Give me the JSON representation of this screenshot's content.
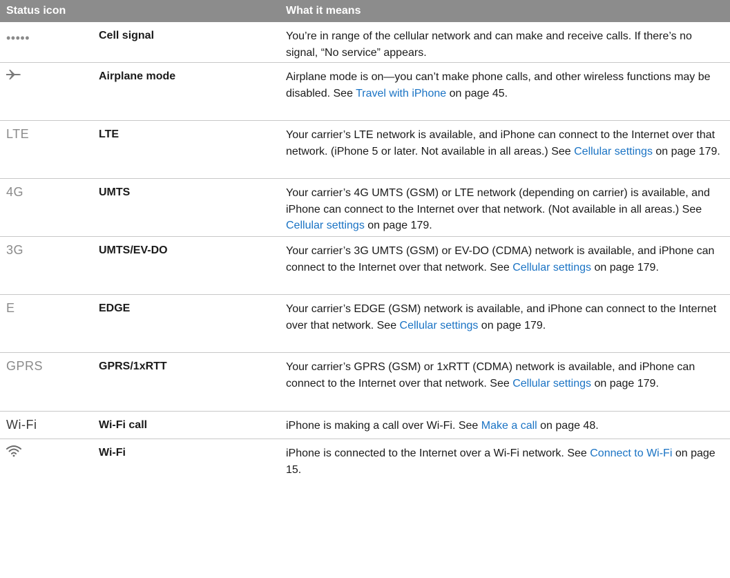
{
  "header": {
    "col1": "Status icon",
    "col2": "What it means"
  },
  "rows": [
    {
      "icon": "•••••",
      "name": "Cell signal",
      "desc": [
        {
          "t": "You’re in range of the cellular network and can make and receive calls. If there’s no signal, “No service” appears."
        }
      ]
    },
    {
      "icon": "airplane-icon",
      "name": "Airplane mode",
      "desc": [
        {
          "t": "Airplane mode is on—you can’t make phone calls, and other wireless functions may be disabled. See "
        },
        {
          "t": "Travel with iPhone",
          "link": true
        },
        {
          "t": " on page 45."
        }
      ]
    },
    {
      "icon": "LTE",
      "name": "LTE",
      "desc": [
        {
          "t": "Your carrier’s LTE network is available, and iPhone can connect to the Internet over that network. (iPhone 5 or later. Not available in all areas.) See "
        },
        {
          "t": "Cellular settings",
          "link": true
        },
        {
          "t": " on page 179."
        }
      ]
    },
    {
      "icon": "4G",
      "name": "UMTS",
      "desc": [
        {
          "t": "Your carrier’s 4G UMTS (GSM) or LTE network (depending on carrier) is available, and iPhone can connect to the Internet over that network. (Not available in all areas.) See "
        },
        {
          "t": "Cellular settings",
          "link": true
        },
        {
          "t": " on page 179."
        }
      ]
    },
    {
      "icon": "3G",
      "name": "UMTS/EV-DO",
      "desc": [
        {
          "t": "Your carrier’s 3G UMTS (GSM) or EV-DO (CDMA) network is available, and iPhone can connect to the Internet over that network. See "
        },
        {
          "t": "Cellular settings",
          "link": true
        },
        {
          "t": " on page 179."
        }
      ]
    },
    {
      "icon": "E",
      "name": "EDGE",
      "desc": [
        {
          "t": "Your carrier’s EDGE (GSM) network is available, and iPhone can connect to the Internet over that network. See "
        },
        {
          "t": "Cellular settings",
          "link": true
        },
        {
          "t": " on page 179."
        }
      ]
    },
    {
      "icon": "GPRS",
      "name": "GPRS/1xRTT",
      "desc": [
        {
          "t": "Your carrier’s GPRS (GSM) or 1xRTT (CDMA) network is available, and iPhone can connect to the Internet over that network. See "
        },
        {
          "t": "Cellular settings",
          "link": true
        },
        {
          "t": " on page 179."
        }
      ]
    },
    {
      "icon": "Wi-Fi",
      "name": "Wi-Fi call",
      "desc": [
        {
          "t": "iPhone is making a call over Wi-Fi. See "
        },
        {
          "t": "Make a call",
          "link": true
        },
        {
          "t": " on page 48."
        }
      ]
    },
    {
      "icon": "wifi-icon",
      "name": "Wi-Fi",
      "desc": [
        {
          "t": "iPhone is connected to the Internet over a Wi-Fi network. See "
        },
        {
          "t": "Connect to Wi-Fi",
          "link": true
        },
        {
          "t": " on page 15."
        }
      ]
    }
  ],
  "colors": {
    "header_bg": "#8c8c8c",
    "link": "#1a73c4",
    "divider": "#c8c8c8",
    "icon": "#8a8a8a"
  }
}
